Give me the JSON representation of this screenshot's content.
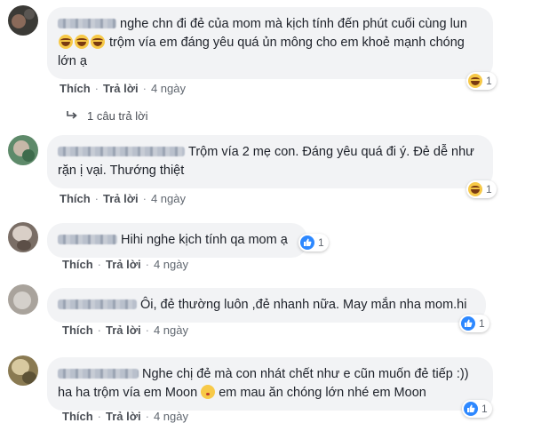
{
  "actions": {
    "like": "Thích",
    "reply": "Trả lời",
    "separator": "·"
  },
  "comments": [
    {
      "text_a": "nghe chn đi đẻ của mom mà kịch tính đến phút cuối cùng lun",
      "text_b": "trộm vía em đáng yêu quá ủn mông cho em khoẻ mạnh chóng lớn ạ",
      "time": "4 ngày",
      "reaction": "haha",
      "reaction_count": "1",
      "avatar_colors": [
        "#3b3a36",
        "#8a6a5a"
      ]
    },
    {
      "text": "Trộm vía 2 mẹ con. Đáng yêu quá đi ý. Đẻ dễ như rặn ị vại. Thướng thiệt",
      "time": "4 ngày",
      "reaction": "haha",
      "reaction_count": "1",
      "avatar_colors": [
        "#5e8a6a",
        "#c7b8a8"
      ]
    },
    {
      "text": "Hihi nghe kịch tính qa mom ạ",
      "time": "4 ngày",
      "reaction": "like",
      "reaction_count": "1",
      "avatar_colors": [
        "#7a6e66",
        "#d9cfc7"
      ]
    },
    {
      "text": "Ôi, đẻ thường luôn ,đẻ nhanh nữa. May mắn nha mom.hi",
      "time": "4 ngày",
      "reaction": "like",
      "reaction_count": "1",
      "avatar_colors": [
        "#a9a39c",
        "#d4d0cb"
      ]
    },
    {
      "text_a": "Nghe chị đẻ mà con nhát chết như e cũn muốn đẻ tiếp :)) ha ha trộm vía em Moon",
      "text_b": "em mau ăn chóng lớn nhé em Moon",
      "time": "4 ngày",
      "reaction": "like",
      "reaction_count": "1",
      "avatar_colors": [
        "#8a7a52",
        "#d8c9a0"
      ]
    }
  ],
  "replies_link": "1 câu trả lời"
}
